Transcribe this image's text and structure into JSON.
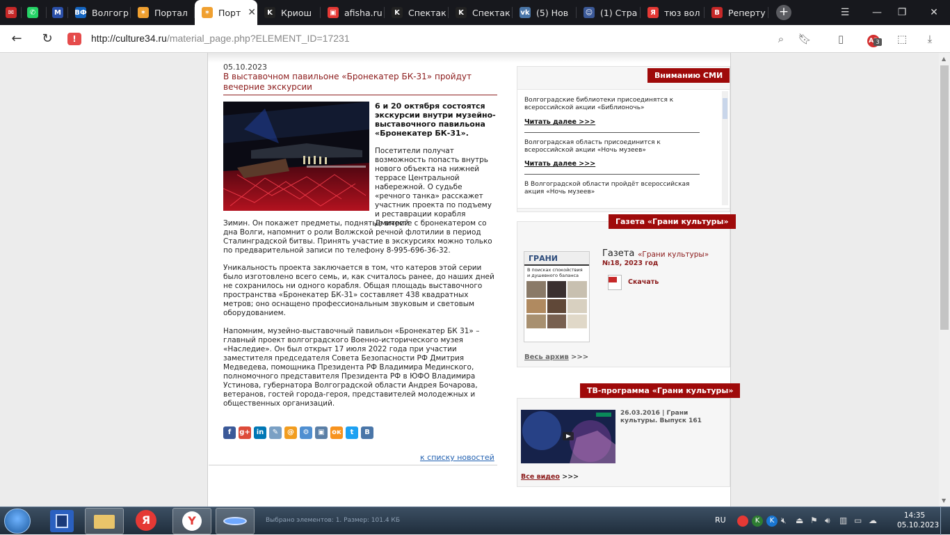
{
  "browser": {
    "tabs": [
      {
        "label": "",
        "icon": "gmail-like-icon",
        "color": "#c62828"
      },
      {
        "label": "",
        "icon": "whatsapp-icon",
        "color": "#25d366"
      },
      {
        "label": "",
        "icon": "m-app-icon",
        "color": "#2a4fa8"
      },
      {
        "label": "Волгогр",
        "icon": "vf-icon",
        "color": "#1565c0"
      },
      {
        "label": "Портал",
        "icon": "portal-icon",
        "color": "#f0a030"
      },
      {
        "label": "Порт",
        "icon": "portal-icon",
        "color": "#f0a030"
      },
      {
        "label": "Криош",
        "icon": "k-icon",
        "color": "#222"
      },
      {
        "label": "afisha.ru",
        "icon": "afisha-icon",
        "color": "#e53935"
      },
      {
        "label": "Спектак",
        "icon": "k-icon",
        "color": "#222"
      },
      {
        "label": "Спектак",
        "icon": "k-icon",
        "color": "#222"
      },
      {
        "label": "(5) Нов",
        "icon": "vk-icon",
        "color": "#4a76a8"
      },
      {
        "label": "(1) Стра",
        "icon": "person-icon",
        "color": "#3b5998"
      },
      {
        "label": "тюз вол",
        "icon": "yandex-icon",
        "color": "#e53935"
      },
      {
        "label": "Реперту",
        "icon": "b-icon",
        "color": "#c62828"
      }
    ],
    "url_host": "http://culture34.ru",
    "url_path": "/material_page.php?ELEMENT_ID=17231",
    "badge_count": "3"
  },
  "article": {
    "date": "05.10.2023",
    "title": "В выставочном павильоне «Бронекатер БК-31» пройдут вечерние экскурсии",
    "lead": "6 и 20 октября состоятся экскурсии внутри музейно-выставочного павильона «Бронекатер БК-31».",
    "p1a": "Посетители получат возможность попасть внутрь нового объекта на нижней террасе Центральной набережной. О судьбе «речного танка» расскажет участник проекта по подъему и реставрации корабля Дмитрий",
    "p1b": "Зимин. Он покажет предметы, поднятые вместе с бронекатером со дна Волги, напомнит о роли Волжской речной флотилии в период Сталинградской битвы. Принять участие в экскурсиях можно только по предварительной записи по телефону 8-995-696-36-32.",
    "p2": "Уникальность проекта заключается в том, что катеров этой серии было изготовлено всего семь, и, как считалось ранее, до наших дней не сохранилось ни одного корабля. Общая площадь выставочного пространства «Бронекатер БК-31» составляет 438 квадратных метров; оно оснащено профессиональным звуковым и световым оборудованием.",
    "p3": "Напомним, музейно-выставочный павильон «Бронекатер БК 31» – главный проект волгоградского Военно-исторического музея «Наследие». Он был открыт 17 июля 2022 года при участии заместителя председателя Совета Безопасности РФ Дмитрия Медведева, помощника Президента РФ Владимира Мединского, полномочного представителя Президента РФ в ЮФО Владимира Устинова, губернатора Волгоградской области Андрея Бочарова, ветеранов, гостей города-героя, представителей молодежных и общественных организаций.",
    "back_link": "к списку новостей"
  },
  "sidebar": {
    "media_head": "Вниманию СМИ",
    "media_items": [
      {
        "text": "Волгоградские библиотеки присоединятся к всероссийской акции «Библионочь»",
        "more": "Читать далее >>>"
      },
      {
        "text": "Волгоградская область присоединится к всероссийской акции «Ночь музеев»",
        "more": "Читать далее >>>"
      },
      {
        "text": "В Волгоградской области пройдёт всероссийская акция «Ночь музеев»",
        "more": ""
      }
    ],
    "paper_head": "Газета «Грани культуры»",
    "paper_word": "Газета",
    "paper_name": "«Грани культуры»",
    "paper_issue": "№18, 2023 год",
    "paper_download": "Скачать",
    "paper_archive": "Весь архив",
    "paper_archive_arrows": ">>>",
    "cover_masthead": "ГРАНИ",
    "cover_headline": "В поисках спокойствия и душевного баланса",
    "tv_head": "ТВ-программа «Грани культуры»",
    "tv_caption": "26.03.2016 | Грани культуры. Выпуск 161",
    "tv_all": "Все видео",
    "tv_all_arrows": ">>>"
  },
  "taskbar": {
    "status_text": "Выбрано элементов: 1. Размер: 101.4 КБ",
    "lang": "RU",
    "time": "14:35",
    "date": "05.10.2023"
  }
}
